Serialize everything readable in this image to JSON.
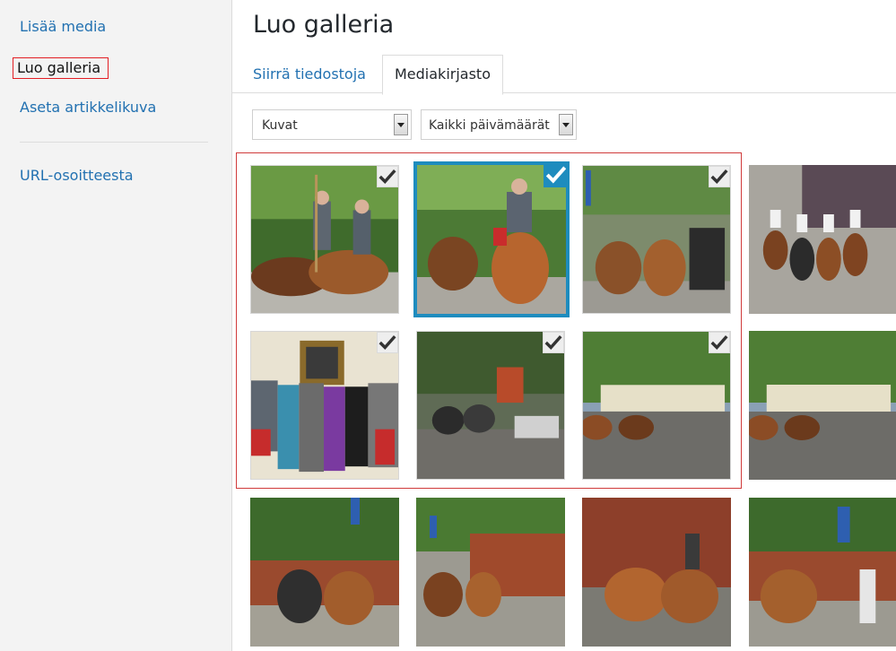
{
  "sidebar": {
    "items": [
      {
        "label": "Lisää media"
      },
      {
        "label": "Luo galleria"
      },
      {
        "label": "Aseta artikkelikuva"
      },
      {
        "label": "URL-osoitteesta"
      }
    ]
  },
  "header": {
    "title": "Luo galleria",
    "tabs": [
      {
        "label": "Siirrä tiedostoja"
      },
      {
        "label": "Mediakirjasto"
      }
    ]
  },
  "filters": {
    "type_value": "Kuvat",
    "date_value": "Kaikki päivämäärät"
  },
  "colors": {
    "accent": "#1e8cbe",
    "link": "#2271b1",
    "selection_outline": "#d03b3b"
  },
  "gallery": {
    "selected_count": 6,
    "row1": [
      "selected",
      "selected-focused",
      "selected",
      "unselected"
    ],
    "row2": [
      "selected",
      "selected",
      "selected",
      "unselected"
    ],
    "row3": [
      "unselected",
      "unselected",
      "unselected",
      "unselected"
    ]
  }
}
